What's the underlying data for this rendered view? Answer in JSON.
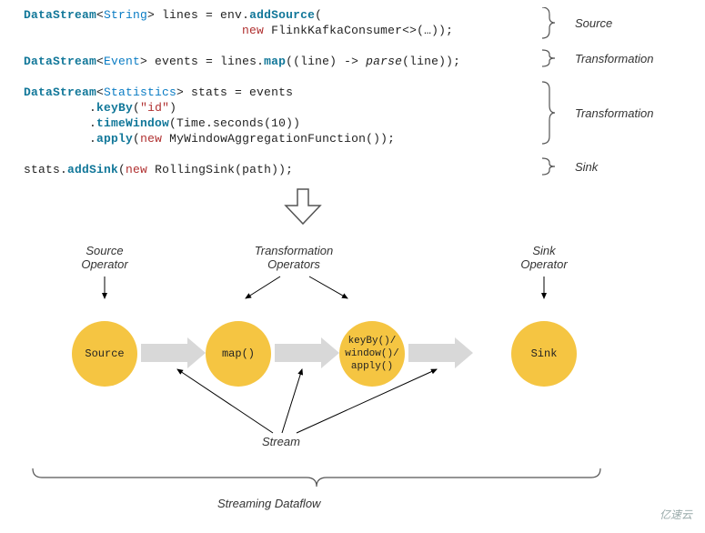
{
  "code": {
    "line1_a": "DataStream",
    "line1_b": "String",
    "line1_c": "> lines = env.",
    "line1_d": "addSource",
    "line1_e": "(",
    "line2_a": "new",
    "line2_b": " FlinkKafkaConsumer<>(…));",
    "line3_a": "DataStream",
    "line3_b": "Event",
    "line3_c": "> events = lines.",
    "line3_d": "map",
    "line3_e": "((line) -> ",
    "line3_f": "parse",
    "line3_g": "(line));",
    "line4_a": "DataStream",
    "line4_b": "Statistics",
    "line4_c": "> stats = events",
    "line5_a": ".",
    "line5_b": "keyBy",
    "line5_c": "(",
    "line5_d": "\"id\"",
    "line5_e": ")",
    "line6_a": ".",
    "line6_b": "timeWindow",
    "line6_c": "(Time.seconds(10))",
    "line7_a": ".",
    "line7_b": "apply",
    "line7_c": "(",
    "line7_d": "new",
    "line7_e": " MyWindowAggregationFunction());",
    "line8_a": "stats.",
    "line8_b": "addSink",
    "line8_c": "(",
    "line8_d": "new",
    "line8_e": " RollingSink(path));"
  },
  "annotations": {
    "source": "Source",
    "transformation": "Transformation",
    "sink": "Sink"
  },
  "nodes": {
    "source_label": "Source\nOperator",
    "transformation_label": "Transformation\nOperators",
    "sink_label": "Sink\nOperator",
    "source": "Source",
    "map": "map()",
    "keyby": "keyBy()/\nwindow()/\napply()",
    "sink": "Sink"
  },
  "labels": {
    "stream": "Stream",
    "dataflow": "Streaming Dataflow"
  },
  "watermark": "亿速云"
}
